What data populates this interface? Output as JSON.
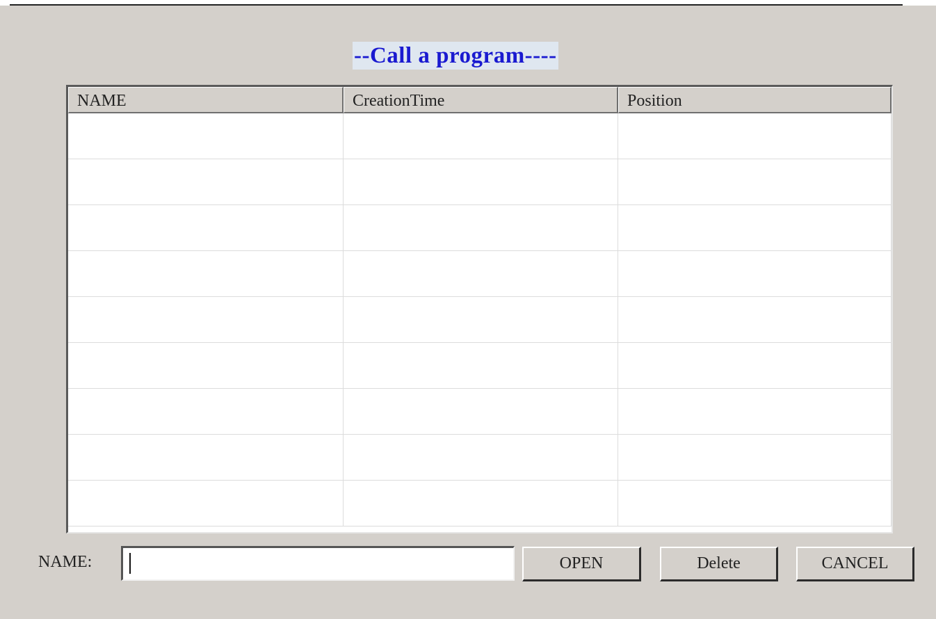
{
  "dialog": {
    "title": "--Call a program----"
  },
  "table": {
    "columns": [
      "NAME",
      "CreationTime",
      "Position"
    ],
    "rows": [
      [
        "",
        "",
        ""
      ],
      [
        "",
        "",
        ""
      ],
      [
        "",
        "",
        ""
      ],
      [
        "",
        "",
        ""
      ],
      [
        "",
        "",
        ""
      ],
      [
        "",
        "",
        ""
      ],
      [
        "",
        "",
        ""
      ],
      [
        "",
        "",
        ""
      ],
      [
        "",
        "",
        ""
      ]
    ]
  },
  "form": {
    "name_label": "NAME:",
    "name_value": ""
  },
  "buttons": {
    "open": "OPEN",
    "delete": "Delete",
    "cancel": "CANCEL"
  },
  "colors": {
    "title_text": "#1a1ad0",
    "title_highlight": "#dfe7f0",
    "dialog_bg": "#d4d0cb"
  }
}
